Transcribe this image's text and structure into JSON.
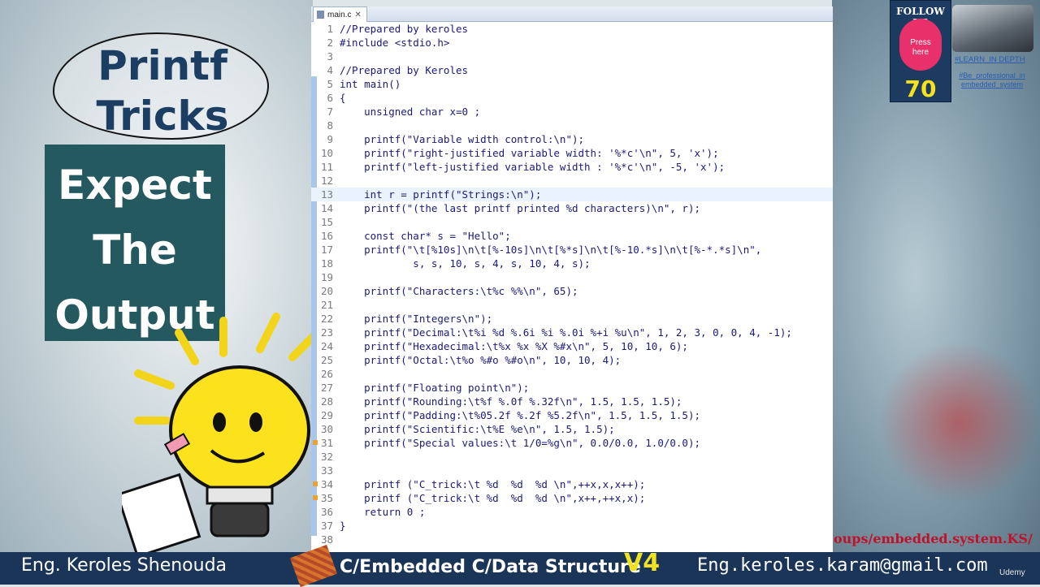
{
  "left_panel": {
    "title": "Printf\nTricks",
    "subtitle": "Expect\nThe\nOutput"
  },
  "editor": {
    "tab_label": "main.c",
    "tab_close": "✕",
    "lines": [
      {
        "n": "1",
        "t": "//Prepared by keroles"
      },
      {
        "n": "2",
        "t": "#include <stdio.h>"
      },
      {
        "n": "3",
        "t": ""
      },
      {
        "n": "4",
        "t": "//Prepared by Keroles"
      },
      {
        "n": "5",
        "t": "int main()"
      },
      {
        "n": "6",
        "t": "{"
      },
      {
        "n": "7",
        "t": "    unsigned char x=0 ;"
      },
      {
        "n": "8",
        "t": ""
      },
      {
        "n": "9",
        "t": "    printf(\"Variable width control:\\n\");"
      },
      {
        "n": "10",
        "t": "    printf(\"right-justified variable width: '%*c'\\n\", 5, 'x');"
      },
      {
        "n": "11",
        "t": "    printf(\"left-justified variable width : '%*c'\\n\", -5, 'x');"
      },
      {
        "n": "12",
        "t": ""
      },
      {
        "n": "13",
        "t": "    int r = printf(\"Strings:\\n\");"
      },
      {
        "n": "14",
        "t": "    printf(\"(the last printf printed %d characters)\\n\", r);"
      },
      {
        "n": "15",
        "t": ""
      },
      {
        "n": "16",
        "t": "    const char* s = \"Hello\";"
      },
      {
        "n": "17",
        "t": "    printf(\"\\t[%10s]\\n\\t[%-10s]\\n\\t[%*s]\\n\\t[%-10.*s]\\n\\t[%-*.*s]\\n\","
      },
      {
        "n": "18",
        "t": "            s, s, 10, s, 4, s, 10, 4, s);"
      },
      {
        "n": "19",
        "t": ""
      },
      {
        "n": "20",
        "t": "    printf(\"Characters:\\t%c %%\\n\", 65);"
      },
      {
        "n": "21",
        "t": ""
      },
      {
        "n": "22",
        "t": "    printf(\"Integers\\n\");"
      },
      {
        "n": "23",
        "t": "    printf(\"Decimal:\\t%i %d %.6i %i %.0i %+i %u\\n\", 1, 2, 3, 0, 0, 4, -1);"
      },
      {
        "n": "24",
        "t": "    printf(\"Hexadecimal:\\t%x %x %X %#x\\n\", 5, 10, 10, 6);"
      },
      {
        "n": "25",
        "t": "    printf(\"Octal:\\t%o %#o %#o\\n\", 10, 10, 4);"
      },
      {
        "n": "26",
        "t": ""
      },
      {
        "n": "27",
        "t": "    printf(\"Floating point\\n\");"
      },
      {
        "n": "28",
        "t": "    printf(\"Rounding:\\t%f %.0f %.32f\\n\", 1.5, 1.5, 1.5);"
      },
      {
        "n": "29",
        "t": "    printf(\"Padding:\\t%05.2f %.2f %5.2f\\n\", 1.5, 1.5, 1.5);"
      },
      {
        "n": "30",
        "t": "    printf(\"Scientific:\\t%E %e\\n\", 1.5, 1.5);"
      },
      {
        "n": "31",
        "t": "    printf(\"Special values:\\t 1/0=%g\\n\", 0.0/0.0, 1.0/0.0);"
      },
      {
        "n": "32",
        "t": ""
      },
      {
        "n": "33",
        "t": ""
      },
      {
        "n": "34",
        "t": "    printf (\"C_trick:\\t %d  %d  %d \\n\",++x,x,x++);"
      },
      {
        "n": "35",
        "t": "    printf (\"C_trick:\\t %d  %d  %d \\n\",x++,++x,x);"
      },
      {
        "n": "36",
        "t": "    return 0 ;"
      },
      {
        "n": "37",
        "t": "}"
      },
      {
        "n": "38",
        "t": ""
      }
    ]
  },
  "follow_badge": {
    "label": "FOLLOW US",
    "button": "Press\nhere",
    "count": "70"
  },
  "tags": {
    "tag1": "#LEARN_IN DEPTH",
    "tag2": "#Be_professional_in\nembedded_system"
  },
  "groups_link": "oups/embedded.system.KS/",
  "bottom_bar": {
    "left": "Eng. Keroles Shenouda",
    "middle": "C/Embedded C/Data Structure",
    "version": "V4",
    "right": "Eng.keroles.karam@gmail.com",
    "watermark": "Udemy"
  }
}
